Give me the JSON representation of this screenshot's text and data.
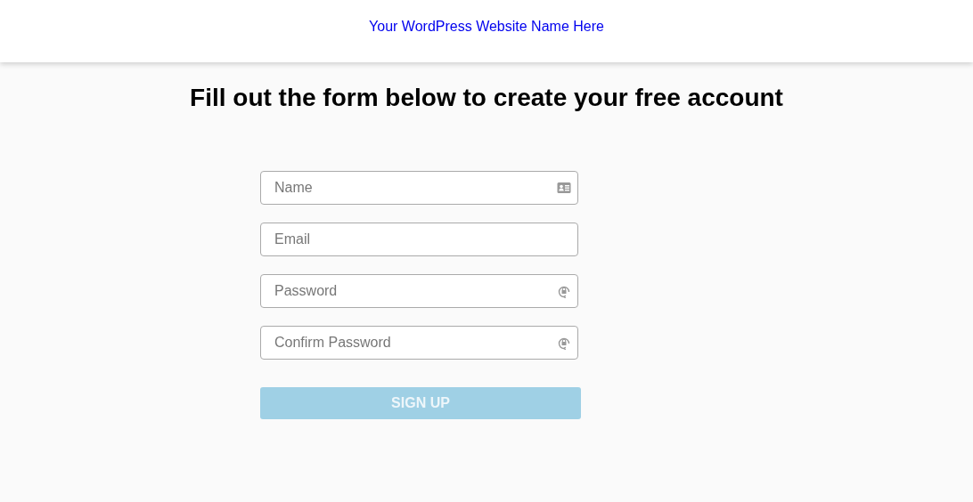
{
  "header": {
    "site_name": "Your WordPress Website Name Here"
  },
  "heading": "Fill out the form below to create your free account",
  "fields": [
    {
      "placeholder": "Name",
      "kind": "name"
    },
    {
      "placeholder": "Email",
      "kind": "email"
    },
    {
      "placeholder": "Password",
      "kind": "password"
    },
    {
      "placeholder": "Confirm Password",
      "kind": "password"
    }
  ],
  "submit": {
    "label": "SIGN UP",
    "disabled": true
  }
}
